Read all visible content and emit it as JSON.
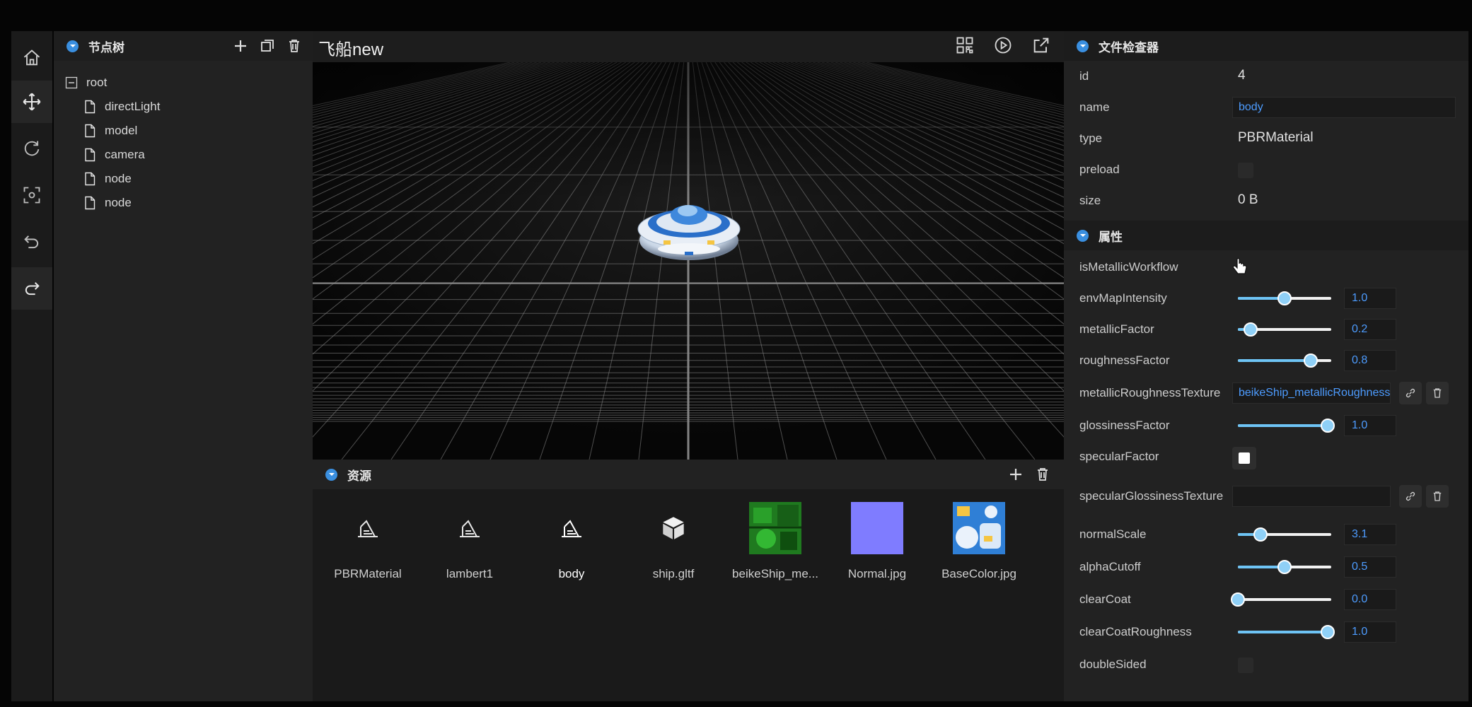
{
  "toolbar": {
    "items": [
      {
        "name": "home-icon",
        "active": false
      },
      {
        "name": "move-icon",
        "active": true
      },
      {
        "name": "rotate-icon",
        "active": false
      },
      {
        "name": "scale-icon",
        "active": false
      },
      {
        "name": "undo-icon",
        "active": false
      },
      {
        "name": "redo-icon",
        "active": false
      }
    ]
  },
  "node_tree": {
    "title": "节点树",
    "root_label": "root",
    "children": [
      "directLight",
      "model",
      "camera",
      "node",
      "node"
    ]
  },
  "viewport": {
    "title": "飞船new"
  },
  "assets": {
    "title": "资源",
    "items": [
      {
        "label": "PBRMaterial",
        "type": "material"
      },
      {
        "label": "lambert1",
        "type": "material"
      },
      {
        "label": "body",
        "type": "material"
      },
      {
        "label": "ship.gltf",
        "type": "model"
      },
      {
        "label": "beikeShip_me...",
        "type": "texture-green"
      },
      {
        "label": "Normal.jpg",
        "type": "texture-normal"
      },
      {
        "label": "BaseColor.jpg",
        "type": "texture-base"
      }
    ]
  },
  "inspector": {
    "file_title": "文件检查器",
    "file_props": {
      "id_label": "id",
      "id_value": "4",
      "name_label": "name",
      "name_value": "body",
      "type_label": "type",
      "type_value": "PBRMaterial",
      "preload_label": "preload",
      "size_label": "size",
      "size_value": "0 B"
    },
    "attr_title": "属性",
    "props": {
      "isMetallicWorkflow": "isMetallicWorkflow",
      "envMapIntensity": {
        "label": "envMapIntensity",
        "value": "1.0",
        "fraction": 0.5
      },
      "metallicFactor": {
        "label": "metallicFactor",
        "value": "0.2",
        "fraction": 0.14
      },
      "roughnessFactor": {
        "label": "roughnessFactor",
        "value": "0.8",
        "fraction": 0.78
      },
      "metallicRoughnessTexture": {
        "label": "metallicRoughnessTexture",
        "value": "beikeShip_metallicRoughness"
      },
      "glossinessFactor": {
        "label": "glossinessFactor",
        "value": "1.0",
        "fraction": 0.96
      },
      "specularFactor": {
        "label": "specularFactor"
      },
      "specularGlossinessTexture": {
        "label": "specularGlossinessTexture",
        "value": ""
      },
      "normalScale": {
        "label": "normalScale",
        "value": "3.1",
        "fraction": 0.24
      },
      "alphaCutoff": {
        "label": "alphaCutoff",
        "value": "0.5",
        "fraction": 0.5
      },
      "clearCoat": {
        "label": "clearCoat",
        "value": "0.0",
        "fraction": 0.0
      },
      "clearCoatRoughness": {
        "label": "clearCoatRoughness",
        "value": "1.0",
        "fraction": 0.96
      },
      "doubleSided": {
        "label": "doubleSided"
      }
    }
  },
  "colors": {
    "accent": "#3a8fe0",
    "link": "#4d9cff",
    "slider_fill": "#6ec4f5"
  }
}
